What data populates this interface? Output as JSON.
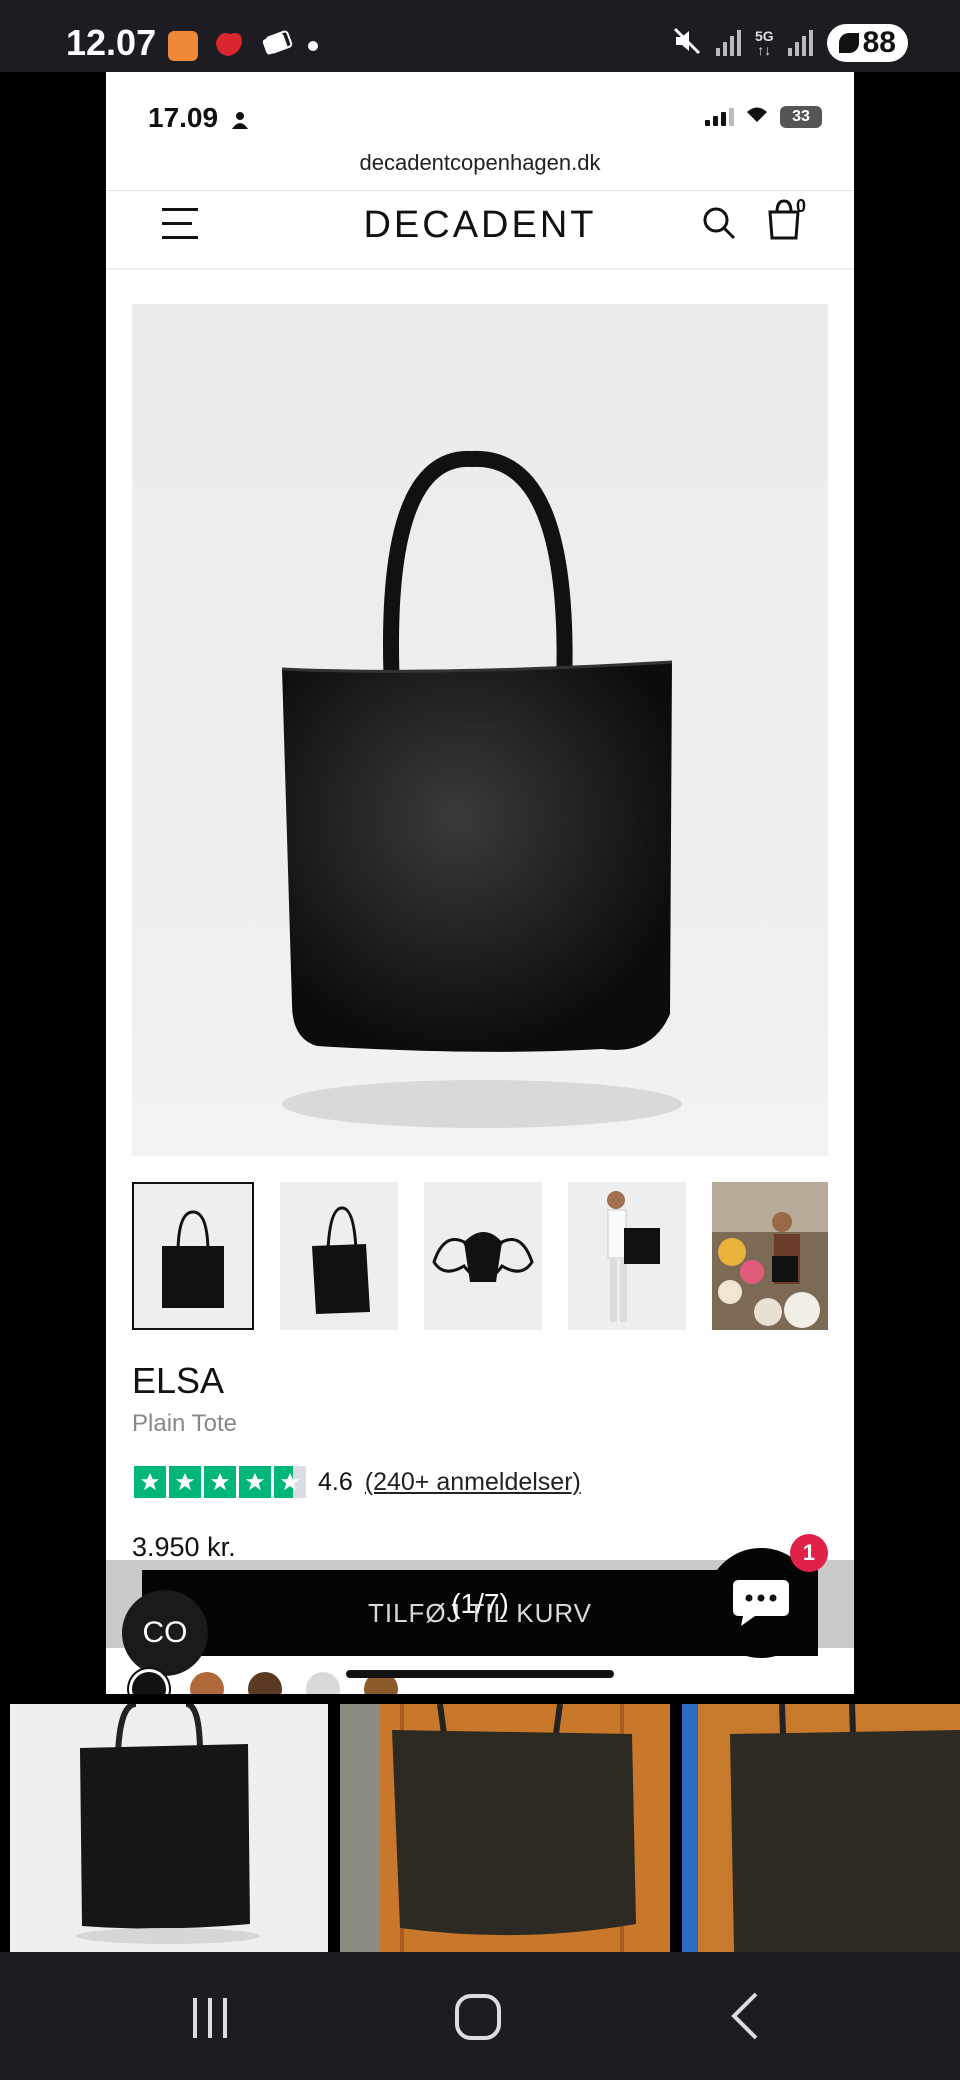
{
  "android_status": {
    "time": "12.07",
    "battery": "88",
    "network": "5G"
  },
  "ios_status": {
    "time": "17.09",
    "battery": "33"
  },
  "browser": {
    "url": "decadentcopenhagen.dk"
  },
  "header": {
    "brand": "DECADENT",
    "cart_count": "0"
  },
  "product": {
    "name": "ELSA",
    "subtitle": "Plain Tote",
    "rating": "4.6",
    "reviews_link": "(240+ anmeldelser)",
    "price": "3.950 kr.",
    "add_to_cart": "TILFØJ TIL KURV",
    "image_counter": "(1/7)",
    "co_label": "CO",
    "chat_badge": "1",
    "stars": 4.6
  },
  "swatches": [
    "#111111",
    "#b0693a",
    "#5a3a22",
    "#d9d9d9",
    "#8a5a2a"
  ],
  "colors": {
    "accent": "#00b67a",
    "badge": "#e0224a",
    "cta_bg": "#050505"
  },
  "gallery_progress": 0.14
}
